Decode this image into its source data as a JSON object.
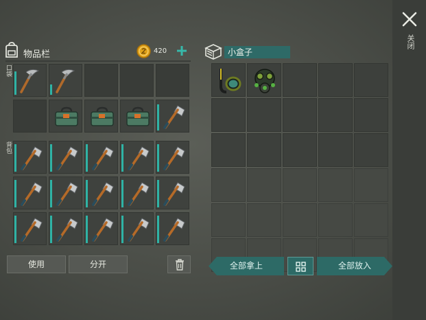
{
  "inventory": {
    "title": "物品栏",
    "coins": "420",
    "pocket_label": "口袋",
    "backpack_label": "背包",
    "pocket_slots": [
      {
        "item": "pickaxe",
        "durability": 0.8
      },
      {
        "item": "pickaxe",
        "durability": 0.35
      },
      {
        "item": "empty"
      },
      {
        "item": "empty"
      },
      {
        "item": "empty"
      },
      {
        "item": "empty"
      },
      {
        "item": "toolbox"
      },
      {
        "item": "toolbox"
      },
      {
        "item": "toolbox"
      },
      {
        "item": "hatchet",
        "durability": 0.9
      }
    ],
    "backpack_slots": [
      {
        "item": "hatchet",
        "durability": 0.95
      },
      {
        "item": "hatchet",
        "durability": 0.95
      },
      {
        "item": "hatchet",
        "durability": 0.95
      },
      {
        "item": "hatchet",
        "durability": 0.95
      },
      {
        "item": "hatchet",
        "durability": 0.95
      },
      {
        "item": "hatchet",
        "durability": 0.95
      },
      {
        "item": "hatchet",
        "durability": 0.95
      },
      {
        "item": "hatchet",
        "durability": 0.95
      },
      {
        "item": "hatchet",
        "durability": 0.95
      },
      {
        "item": "hatchet",
        "durability": 0.95
      },
      {
        "item": "hatchet",
        "durability": 0.95
      },
      {
        "item": "hatchet",
        "durability": 0.95
      },
      {
        "item": "hatchet",
        "durability": 0.95
      },
      {
        "item": "hatchet",
        "durability": 0.95
      },
      {
        "item": "hatchet",
        "durability": 0.95
      }
    ],
    "buttons": {
      "use": "使用",
      "split": "分开"
    }
  },
  "container": {
    "name": "小盒子",
    "slots": [
      {
        "item": "snorkel"
      },
      {
        "item": "gas-mask"
      },
      {
        "item": "empty"
      },
      {
        "item": "empty"
      },
      {
        "item": "empty"
      },
      {
        "item": "empty"
      },
      {
        "item": "empty"
      },
      {
        "item": "empty"
      },
      {
        "item": "empty"
      },
      {
        "item": "empty"
      },
      {
        "item": "empty"
      },
      {
        "item": "empty"
      },
      {
        "item": "empty"
      },
      {
        "item": "empty"
      },
      {
        "item": "empty"
      },
      {
        "item": "locked"
      },
      {
        "item": "locked"
      },
      {
        "item": "locked"
      },
      {
        "item": "locked"
      },
      {
        "item": "locked"
      },
      {
        "item": "locked"
      },
      {
        "item": "locked"
      },
      {
        "item": "locked"
      },
      {
        "item": "locked"
      },
      {
        "item": "locked"
      },
      {
        "item": "locked"
      },
      {
        "item": "locked"
      },
      {
        "item": "locked"
      },
      {
        "item": "locked"
      },
      {
        "item": "locked"
      }
    ],
    "buttons": {
      "take_all": "全部拿上",
      "put_all": "全部放入"
    }
  },
  "close_label": "关闭",
  "colors": {
    "accent": "#2d6a66",
    "durability": "#2fb3a5",
    "coin": "#e0a21a"
  },
  "icons": [
    "backpack-icon",
    "coin-icon",
    "plus-icon",
    "box-icon",
    "close-icon",
    "trash-icon",
    "grid-icon"
  ]
}
